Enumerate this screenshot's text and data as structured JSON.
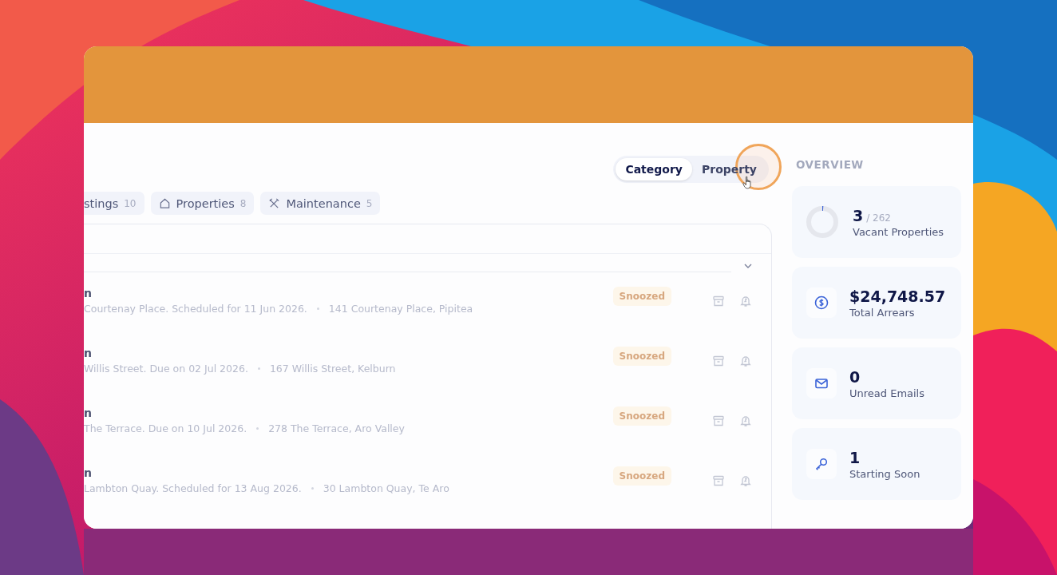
{
  "view_toggle": [
    {
      "label": "Category",
      "selected": true
    },
    {
      "label": "Property",
      "selected": false
    }
  ],
  "tabs": [
    {
      "label": "stings",
      "count": "10"
    },
    {
      "label": "Properties",
      "count": "8"
    },
    {
      "label": "Maintenance",
      "count": "5"
    }
  ],
  "items": [
    {
      "title": "n",
      "description": "Courtenay Place. Scheduled for 11 Jun 2026.",
      "address": "141 Courtenay Place, Pipitea",
      "status": "Snoozed"
    },
    {
      "title": "n",
      "description": "Willis Street. Due on 02 Jul 2026.",
      "address": "167 Willis Street, Kelburn",
      "status": "Snoozed"
    },
    {
      "title": "n",
      "description": "The Terrace. Due on 10 Jul 2026.",
      "address": "278 The Terrace, Aro Valley",
      "status": "Snoozed"
    },
    {
      "title": "n",
      "description": "Lambton Quay. Scheduled for 13 Aug 2026.",
      "address": "30 Lambton Quay, Te Aro",
      "status": "Snoozed"
    }
  ],
  "overview": {
    "title": "OVERVIEW",
    "cards": [
      {
        "kind": "ring",
        "value": "3",
        "total": "/ 262",
        "label": "Vacant Properties",
        "level": 0.011
      },
      {
        "kind": "dollar",
        "value": "$24,748.57",
        "label": "Total Arrears"
      },
      {
        "kind": "mail",
        "value": "0",
        "label": "Unread Emails"
      },
      {
        "kind": "key",
        "value": "1",
        "label": "Starting Soon"
      }
    ]
  }
}
